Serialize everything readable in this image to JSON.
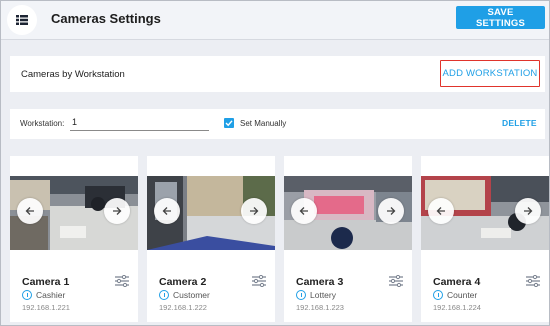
{
  "header": {
    "title": "Cameras Settings",
    "save_label": "SAVE SETTINGS",
    "menu_icon": "grid-list-icon"
  },
  "workstations_panel": {
    "label": "Cameras by Workstation",
    "add_label": "ADD WORKSTATION"
  },
  "workstation_row": {
    "label": "Workstation:",
    "value": "1",
    "checkbox_label": "Set Manually",
    "checked": true,
    "delete_label": "DELETE"
  },
  "cameras": [
    {
      "name": "Camera 1",
      "role": "Cashier",
      "ip": "192.168.1.221"
    },
    {
      "name": "Camera 2",
      "role": "Customer",
      "ip": "192.168.1.222"
    },
    {
      "name": "Camera 3",
      "role": "Lottery",
      "ip": "192.168.1.223"
    },
    {
      "name": "Camera 4",
      "role": "Counter",
      "ip": "192.168.1.224"
    }
  ],
  "colors": {
    "accent": "#1f9fe6",
    "highlight_border": "#e0342c"
  }
}
